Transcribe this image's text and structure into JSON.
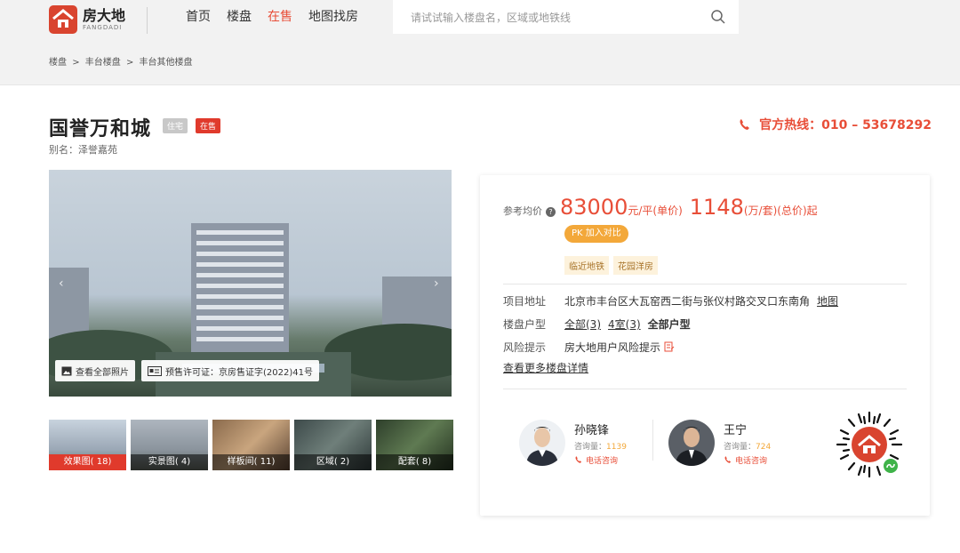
{
  "header": {
    "logo_cn": "房大地",
    "logo_en": "FANGDADI",
    "nav": [
      "首页",
      "楼盘",
      "在售",
      "地图找房"
    ],
    "nav_active": 2,
    "search_placeholder": "请试试输入楼盘名，区域或地铁线"
  },
  "breadcrumb": [
    "楼盘",
    ">",
    "丰台楼盘",
    ">",
    "丰台其他楼盘"
  ],
  "project": {
    "title": "国誉万和城",
    "tag_type": "住宅",
    "tag_status": "在售",
    "alias": "别名：泽誉嘉苑",
    "hotline": "官方热线：010 – 53678292"
  },
  "gallery": {
    "view_all": "查看全部照片",
    "permit": "预售许可证：京房售证字(2022)41号",
    "thumbs": [
      {
        "label": "效果图( 18)",
        "active": true
      },
      {
        "label": "实景图( 4)",
        "active": false
      },
      {
        "label": "样板间( 11)",
        "active": false
      },
      {
        "label": "区域( 2)",
        "active": false
      },
      {
        "label": "配套( 8)",
        "active": false
      }
    ]
  },
  "price": {
    "label": "参考均价",
    "unit_price": "83000",
    "unit_price_unit": "元/平(单价)",
    "total_price": "1148",
    "total_price_unit": "(万/套)(总价)起",
    "pk_button": "PK 加入对比",
    "features": [
      "临近地铁",
      "花园洋房"
    ]
  },
  "details": {
    "address_label": "项目地址",
    "address": "北京市丰台区大瓦窑西二街与张仪村路交叉口东南角",
    "map_link": "地图",
    "layout_label": "楼盘户型",
    "layout_all": "全部(3)",
    "layout_4": "4室(3)",
    "layout_all_types": "全部户型",
    "risk_label": "风险提示",
    "risk_text": "房大地用户风险提示",
    "more": "查看更多楼盘详情"
  },
  "agents": [
    {
      "name": "孙晓锋",
      "count_label": "咨询量：",
      "count": "1139",
      "call": "电话咨询"
    },
    {
      "name": "王宁",
      "count_label": "咨询量：",
      "count": "724",
      "call": "电话咨询"
    }
  ],
  "colors": {
    "accent": "#e84e38",
    "tag_red": "#e03a2c",
    "pk": "#f3a83a"
  }
}
